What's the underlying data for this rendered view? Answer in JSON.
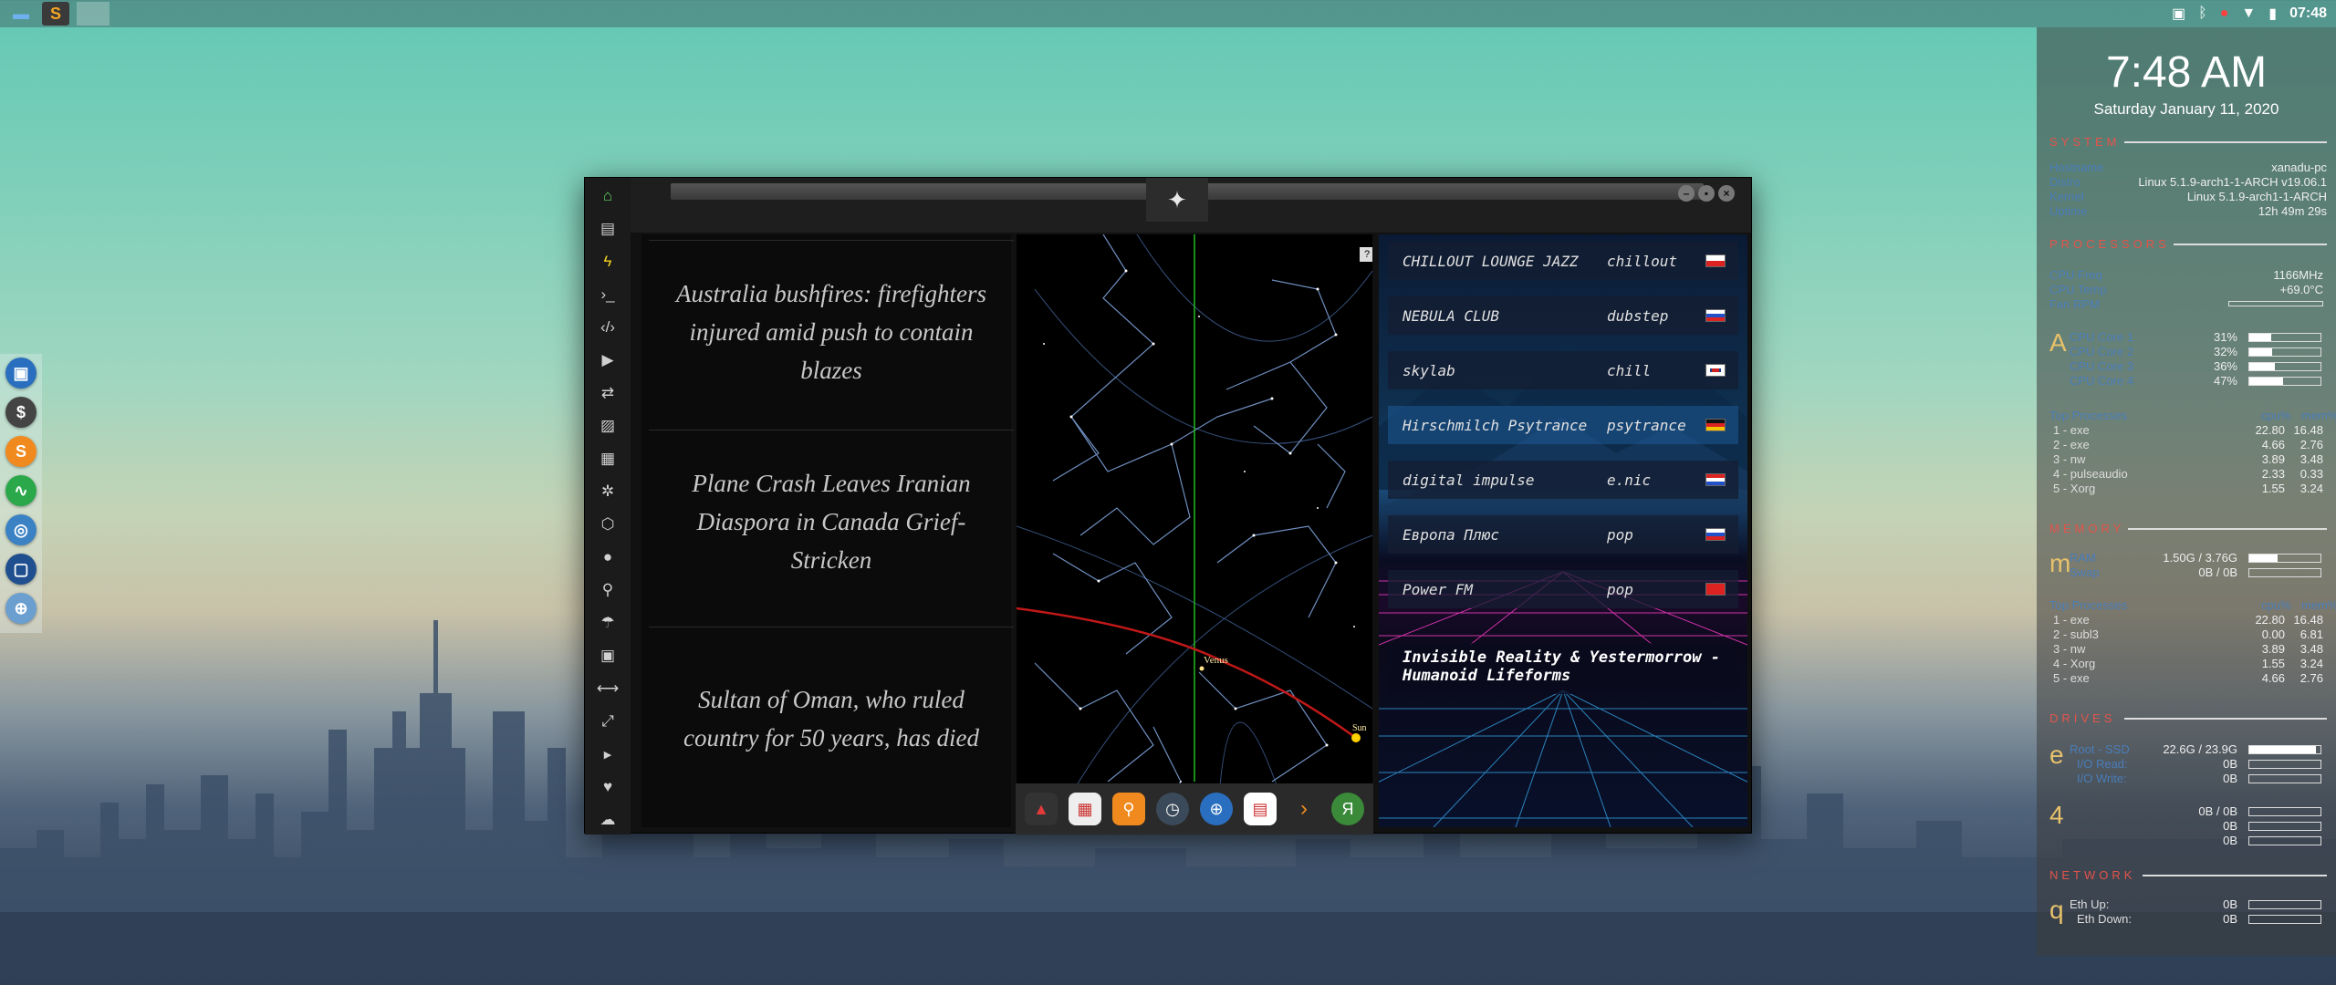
{
  "taskbar": {
    "apps": [
      {
        "name": "folder-icon",
        "glyph": "▬"
      },
      {
        "name": "sublime-icon",
        "glyph": "S"
      }
    ],
    "tray_clock": "07:48"
  },
  "left_dock": [
    {
      "name": "calendar-app-icon",
      "glyph": "▣",
      "color": "#2a6fbf"
    },
    {
      "name": "money-app-icon",
      "glyph": "$",
      "color": "#444444"
    },
    {
      "name": "stocks-app-icon",
      "glyph": "S",
      "color": "#f08a1e"
    },
    {
      "name": "activity-app-icon",
      "glyph": "∿",
      "color": "#2aa84a"
    },
    {
      "name": "chrome-app-icon",
      "glyph": "◎",
      "color": "#3b82c4"
    },
    {
      "name": "screen-app-icon",
      "glyph": "▢",
      "color": "#1f4f8f"
    },
    {
      "name": "globe-app-icon",
      "glyph": "⊕",
      "color": "#6a9fd0"
    }
  ],
  "news": [
    {
      "headline": "Australia bushfires: firefighters injured amid push to contain blazes"
    },
    {
      "headline": "Plane Crash Leaves Iranian Diaspora in Canada Grief-Stricken"
    },
    {
      "headline": "Sultan of Oman, who ruled country for 50 years, has died"
    }
  ],
  "star_map": {
    "labels": {
      "venus": "Venus",
      "sun": "Sun"
    },
    "help": "?"
  },
  "radio": {
    "stations": [
      {
        "name": "CHILLOUT LOUNGE JAZZ",
        "genre": "chillout",
        "flag": "pl"
      },
      {
        "name": "NEBULA CLUB",
        "genre": "dubstep",
        "flag": "ru"
      },
      {
        "name": "skylab",
        "genre": "chill",
        "flag": "gb"
      },
      {
        "name": "Hirschmilch Psytrance",
        "genre": "psytrance",
        "flag": "de"
      },
      {
        "name": "digital impulse",
        "genre": "e.nic",
        "flag": "hr"
      },
      {
        "name": "Европа Плюс",
        "genre": "pop",
        "flag": "ru"
      },
      {
        "name": "Power FM",
        "genre": "pop",
        "flag": "tr"
      }
    ],
    "now_playing": "Invisible Reality & Yestermorrow - Humanoid Lifeforms"
  },
  "conky": {
    "time": "7:48 AM",
    "date": "Saturday January 11, 2020",
    "system": {
      "title": "SYSTEM",
      "rows": [
        {
          "label": "Hostname",
          "value": "xanadu-pc"
        },
        {
          "label": "Distro",
          "value": "Linux 5.1.9-arch1-1-ARCH v19.06.1"
        },
        {
          "label": "Kernel",
          "value": "Linux 5.1.9-arch1-1-ARCH"
        },
        {
          "label": "Uptime",
          "value": "12h 49m 29s"
        }
      ]
    },
    "processors": {
      "title": "PROCESSORS",
      "freq_label": "CPU Freq",
      "freq": "1166MHz",
      "temp_label": "CPU Temp",
      "temp": "+69.0°C",
      "fan_label": "Fan RPM",
      "letter": "A",
      "cores": [
        {
          "label": "CPU Core 1",
          "value": "31%",
          "pct": 31
        },
        {
          "label": "CPU Core 2",
          "value": "32%",
          "pct": 32
        },
        {
          "label": "CPU Core 3",
          "value": "36%",
          "pct": 36
        },
        {
          "label": "CPU Core 4",
          "value": "47%",
          "pct": 47
        }
      ],
      "top_header": "Top Processes",
      "col1": "cpu%",
      "col2": "mem%",
      "top": [
        {
          "rank": "1",
          "name": "exe",
          "cpu": "22.80",
          "mem": "16.48"
        },
        {
          "rank": "2",
          "name": "exe",
          "cpu": "4.66",
          "mem": "2.76"
        },
        {
          "rank": "3",
          "name": "nw",
          "cpu": "3.89",
          "mem": "3.48"
        },
        {
          "rank": "4",
          "name": "pulseaudio",
          "cpu": "2.33",
          "mem": "0.33"
        },
        {
          "rank": "5",
          "name": "Xorg",
          "cpu": "1.55",
          "mem": "3.24"
        }
      ]
    },
    "memory": {
      "title": "MEMORY",
      "letter": "m",
      "ram_label": "RAM",
      "ram": "1.50G / 3.76G",
      "ram_pct": 40,
      "swap_label": "Swap",
      "swap": "0B / 0B",
      "swap_pct": 0,
      "top_header": "Top Processes",
      "col1": "cpu%",
      "col2": "mem%",
      "top": [
        {
          "rank": "1",
          "name": "exe",
          "cpu": "22.80",
          "mem": "16.48"
        },
        {
          "rank": "2",
          "name": "subl3",
          "cpu": "0.00",
          "mem": "6.81"
        },
        {
          "rank": "3",
          "name": "nw",
          "cpu": "3.89",
          "mem": "3.48"
        },
        {
          "rank": "4",
          "name": "Xorg",
          "cpu": "1.55",
          "mem": "3.24"
        },
        {
          "rank": "5",
          "name": "exe",
          "cpu": "4.66",
          "mem": "2.76"
        }
      ]
    },
    "drives": {
      "title": "DRIVES",
      "letter1": "e",
      "letter2": "4",
      "root_label": "Root - SSD",
      "root": "22.6G / 23.9G",
      "root_pct": 94,
      "io_read_label": "I/O Read:",
      "io_read": "0B",
      "io_write_label": "I/O Write:",
      "io_write": "0B",
      "d2": "0B / 0B",
      "d2_read": "0B",
      "d2_write": "0B"
    },
    "network": {
      "title": "NETWORK",
      "letter": "q",
      "up_label": "Eth Up:",
      "up": "0B",
      "down_label": "Eth Down:",
      "down": "0B"
    }
  }
}
